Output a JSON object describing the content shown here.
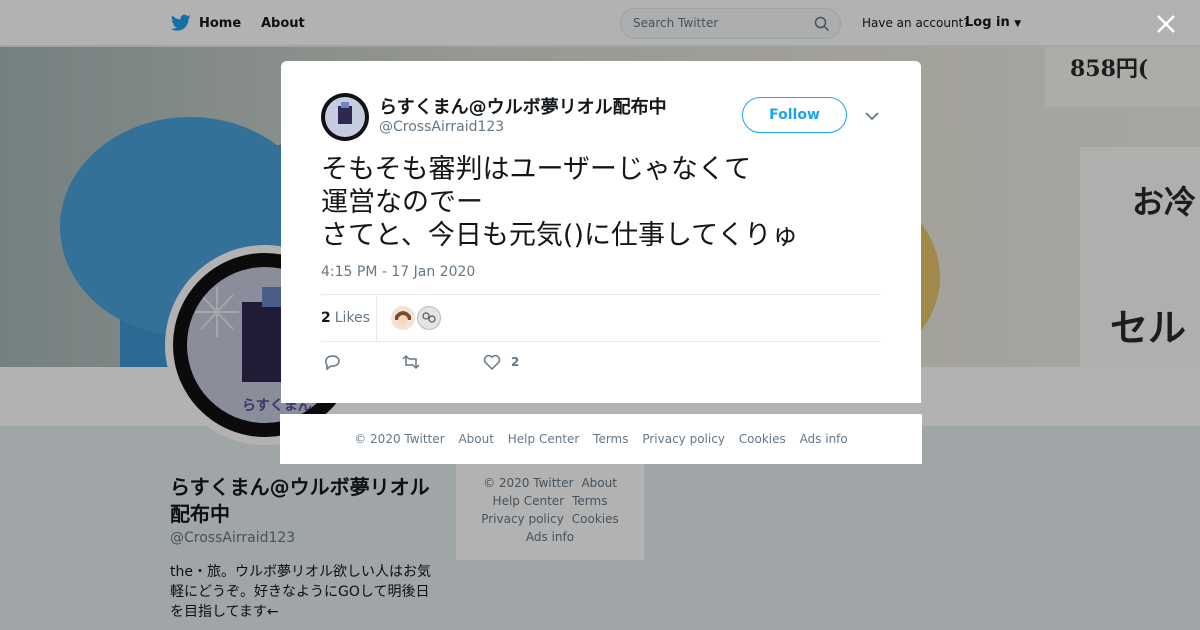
{
  "nav": {
    "home_label": "Home",
    "about_label": "About",
    "search_placeholder": "Search Twitter",
    "have_account": "Have an account?",
    "login_label": "Log in"
  },
  "banner": {
    "sign_top": "858円(",
    "sign_mid": "お冷",
    "sign_bottom": "セルフ"
  },
  "profile": {
    "name": "らすくまん@ウルボ夢リオル配布中",
    "handle": "@CrossAirraid123",
    "avatar_text": "らすくまん",
    "bio": "the・旅。ウルボ夢リオル欲しい人はお気軽にどうぞ。好きなようにGOして明後日を目指してます←"
  },
  "side_footer": {
    "links": [
      "© 2020 Twitter",
      "About",
      "Help Center",
      "Terms",
      "Privacy policy",
      "Cookies",
      "Ads info"
    ]
  },
  "tweet": {
    "author_name": "らすくまん@ウルボ夢リオル配布中",
    "author_handle": "@CrossAirraid123",
    "follow_label": "Follow",
    "text": "そもそも審判はユーザーじゃなくて\n運営なのでー\nさてと、今日も元気()に仕事してくりゅ",
    "timestamp": "4:15 PM - 17 Jan 2020",
    "likes_count": "2",
    "likes_label": "Likes",
    "like_action_count": "2"
  },
  "modal_footer": {
    "links": [
      "© 2020 Twitter",
      "About",
      "Help Center",
      "Terms",
      "Privacy policy",
      "Cookies",
      "Ads info"
    ]
  },
  "colors": {
    "accent": "#1da1f2",
    "muted": "#657786",
    "text": "#14171a"
  }
}
